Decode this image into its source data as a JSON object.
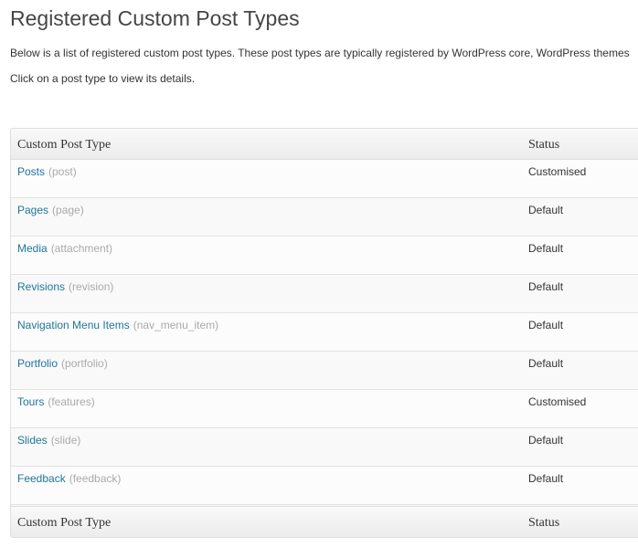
{
  "page": {
    "title": "Registered Custom Post Types",
    "description": "Below is a list of registered custom post types. These post types are typically registered by WordPress core, WordPress themes",
    "instruction": "Click on a post type to view its details."
  },
  "table": {
    "header": {
      "name": "Custom Post Type",
      "status": "Status"
    },
    "footer": {
      "name": "Custom Post Type",
      "status": "Status"
    },
    "rows": [
      {
        "label": "Posts",
        "slug": "(post)",
        "status": "Customised"
      },
      {
        "label": "Pages",
        "slug": "(page)",
        "status": "Default"
      },
      {
        "label": "Media",
        "slug": "(attachment)",
        "status": "Default"
      },
      {
        "label": "Revisions",
        "slug": "(revision)",
        "status": "Default"
      },
      {
        "label": "Navigation Menu Items",
        "slug": "(nav_menu_item)",
        "status": "Default"
      },
      {
        "label": "Portfolio",
        "slug": "(portfolio)",
        "status": "Default"
      },
      {
        "label": "Tours",
        "slug": "(features)",
        "status": "Customised"
      },
      {
        "label": "Slides",
        "slug": "(slide)",
        "status": "Default"
      },
      {
        "label": "Feedback",
        "slug": "(feedback)",
        "status": "Default"
      }
    ]
  },
  "colors": {
    "link": "#21759b",
    "slug": "#aaaaaa",
    "text": "#333333",
    "title": "#464646"
  }
}
